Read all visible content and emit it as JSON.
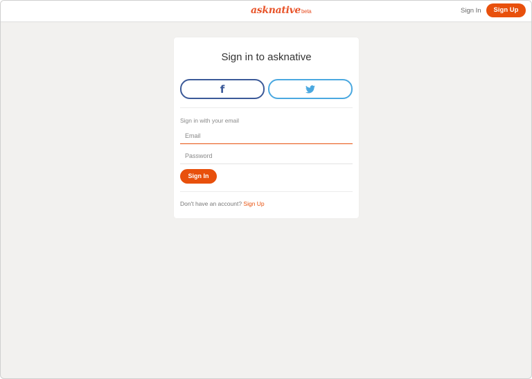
{
  "header": {
    "logo": "asknative",
    "logo_badge": "beta",
    "signin_label": "Sign In",
    "signup_label": "Sign Up"
  },
  "card": {
    "title": "Sign in to asknative",
    "facebook_icon": "facebook-icon",
    "twitter_icon": "twitter-icon",
    "email_caption": "Sign in with your email",
    "email_placeholder": "Email",
    "password_placeholder": "Password",
    "signin_button": "Sign In",
    "footer_prompt": "Don't have an account?",
    "footer_link": "Sign Up"
  },
  "colors": {
    "accent": "#e8500c",
    "facebook": "#3b5998",
    "twitter": "#4aa8e0",
    "background": "#f2f1ef"
  }
}
